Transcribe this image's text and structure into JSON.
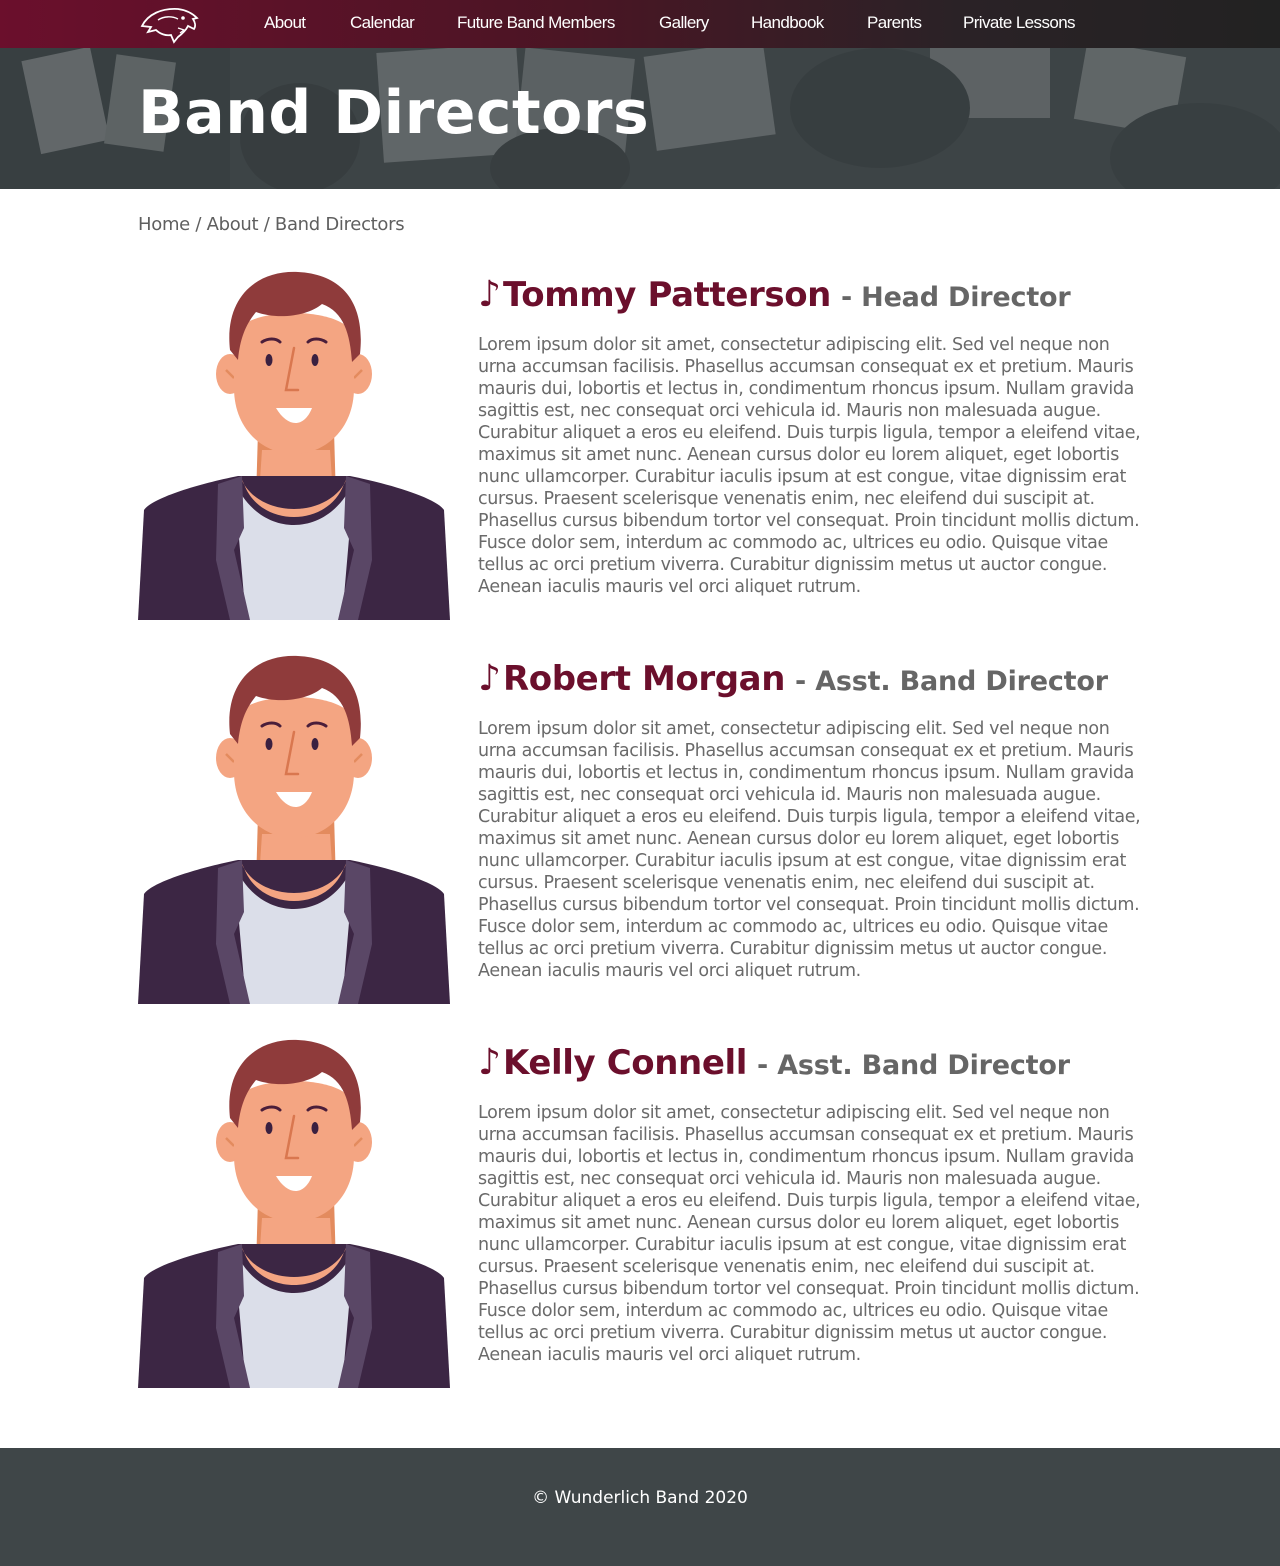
{
  "nav": {
    "logo": "panther-logo",
    "links": [
      "About",
      "Calendar",
      "Future Band Members",
      "Gallery",
      "Handbook",
      "Parents",
      "Private Lessons"
    ]
  },
  "hero": {
    "title": "Band Directors"
  },
  "breadcrumb": {
    "home": "Home",
    "about": "About",
    "current": "Band Directors",
    "separator": "/"
  },
  "note_glyph": "♪",
  "directors": [
    {
      "name": "Tommy Patterson",
      "role": "- Head Director",
      "bio": "Lorem ipsum dolor sit amet, consectetur adipiscing elit. Sed vel neque non urna accumsan facilisis. Phasellus accumsan consequat ex et pretium. Mauris mauris dui, lobortis et lectus in, condimentum rhoncus ipsum. Nullam gravida sagittis est, nec consequat orci vehicula id. Mauris non malesuada augue. Curabitur aliquet a eros eu eleifend. Duis turpis ligula, tempor a eleifend vitae, maximus sit amet nunc. Aenean cursus dolor eu lorem aliquet, eget lobortis nunc ullamcorper. Curabitur iaculis ipsum at est congue, vitae dignissim erat cursus. Praesent scelerisque venenatis enim, nec eleifend dui suscipit at. Phasellus cursus bibendum tortor vel consequat. Proin tincidunt mollis dictum. Fusce dolor sem, interdum ac commodo ac, ultrices eu odio. Quisque vitae tellus ac orci pretium viverra. Curabitur dignissim metus ut auctor congue. Aenean iaculis mauris vel orci aliquet rutrum."
    },
    {
      "name": "Robert Morgan",
      "role": "- Asst. Band Director",
      "bio": "Lorem ipsum dolor sit amet, consectetur adipiscing elit. Sed vel neque non urna accumsan facilisis. Phasellus accumsan consequat ex et pretium. Mauris mauris dui, lobortis et lectus in, condimentum rhoncus ipsum. Nullam gravida sagittis est, nec consequat orci vehicula id. Mauris non malesuada augue. Curabitur aliquet a eros eu eleifend. Duis turpis ligula, tempor a eleifend vitae, maximus sit amet nunc. Aenean cursus dolor eu lorem aliquet, eget lobortis nunc ullamcorper. Curabitur iaculis ipsum at est congue, vitae dignissim erat cursus. Praesent scelerisque venenatis enim, nec eleifend dui suscipit at. Phasellus cursus bibendum tortor vel consequat. Proin tincidunt mollis dictum. Fusce dolor sem, interdum ac commodo ac, ultrices eu odio. Quisque vitae tellus ac orci pretium viverra. Curabitur dignissim metus ut auctor congue. Aenean iaculis mauris vel orci aliquet rutrum."
    },
    {
      "name": "Kelly Connell",
      "role": "- Asst. Band Director",
      "bio": "Lorem ipsum dolor sit amet, consectetur adipiscing elit. Sed vel neque non urna accumsan facilisis. Phasellus accumsan consequat ex et pretium. Mauris mauris dui, lobortis et lectus in, condimentum rhoncus ipsum. Nullam gravida sagittis est, nec consequat orci vehicula id. Mauris non malesuada augue. Curabitur aliquet a eros eu eleifend. Duis turpis ligula, tempor a eleifend vitae, maximus sit amet nunc. Aenean cursus dolor eu lorem aliquet, eget lobortis nunc ullamcorper. Curabitur iaculis ipsum at est congue, vitae dignissim erat cursus. Praesent scelerisque venenatis enim, nec eleifend dui suscipit at. Phasellus cursus bibendum tortor vel consequat. Proin tincidunt mollis dictum. Fusce dolor sem, interdum ac commodo ac, ultrices eu odio. Quisque vitae tellus ac orci pretium viverra. Curabitur dignissim metus ut auctor congue. Aenean iaculis mauris vel orci aliquet rutrum."
    }
  ],
  "footer": {
    "copyright": "© Wunderlich Band 2020"
  },
  "colors": {
    "brand": "#6b0f2c",
    "footer": "#3f4648",
    "text_gray": "#6a6a6a"
  }
}
